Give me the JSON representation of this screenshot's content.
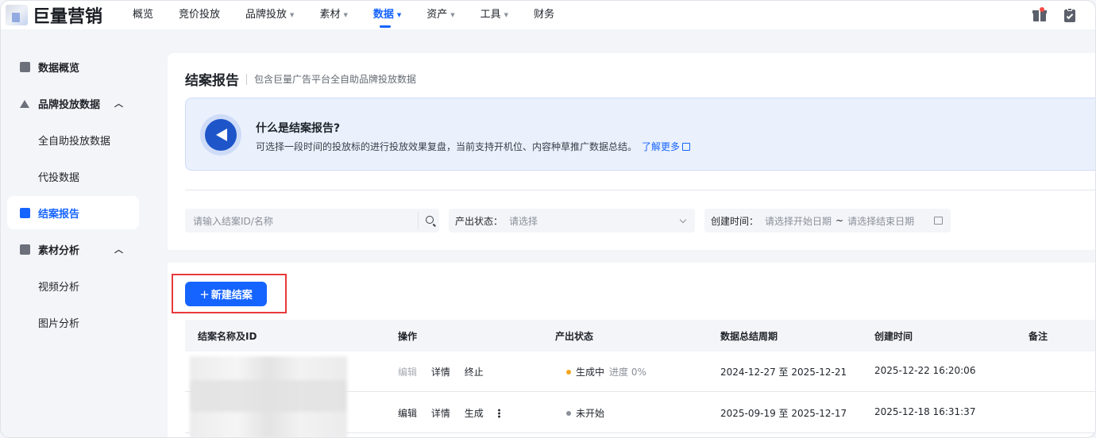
{
  "app": {
    "logo_text": "巨量营销"
  },
  "nav": {
    "items": [
      {
        "label": "概览",
        "has_caret": false,
        "active": false
      },
      {
        "label": "竞价投放",
        "has_caret": false,
        "active": false
      },
      {
        "label": "品牌投放",
        "has_caret": true,
        "active": false
      },
      {
        "label": "素材",
        "has_caret": true,
        "active": false
      },
      {
        "label": "数据",
        "has_caret": true,
        "active": true
      },
      {
        "label": "资产",
        "has_caret": true,
        "active": false
      },
      {
        "label": "工具",
        "has_caret": true,
        "active": false
      },
      {
        "label": "财务",
        "has_caret": false,
        "active": false
      }
    ],
    "right_icons": [
      "gift-icon",
      "clipboard-check-icon"
    ]
  },
  "sidebar": {
    "items": [
      {
        "label": "数据概览",
        "type": "group",
        "icon": "chart-icon"
      },
      {
        "label": "品牌投放数据",
        "type": "group",
        "icon": "crown-icon",
        "chevron": "︿"
      },
      {
        "label": "全自助投放数据",
        "type": "sub"
      },
      {
        "label": "代投数据",
        "type": "sub"
      },
      {
        "label": "结案报告",
        "type": "active",
        "icon": "trend-icon"
      },
      {
        "label": "素材分析",
        "type": "group",
        "icon": "material-icon",
        "chevron": "︿"
      },
      {
        "label": "视频分析",
        "type": "sub"
      },
      {
        "label": "图片分析",
        "type": "sub"
      }
    ]
  },
  "page": {
    "title": "结案报告",
    "description": "包含巨量广告平台全自助品牌投放数据"
  },
  "info": {
    "title": "什么是结案报告?",
    "text": "可选择一段时间的投放标的进行投放效果复盘，当前支持开机位、内容种草推广数据总结。",
    "link": "了解更多"
  },
  "filters": {
    "search_placeholder": "请输入结案ID/名称",
    "status_label": "产出状态：",
    "status_placeholder": "请选择",
    "date_label": "创建时间：",
    "date_start_placeholder": "请选择开始日期",
    "date_sep": "~",
    "date_end_placeholder": "请选择结束日期"
  },
  "actions": {
    "new_button": "新建结案",
    "new_button_icon": "+"
  },
  "table": {
    "headers": [
      "结案名称及ID",
      "操作",
      "产出状态",
      "数据总结周期",
      "创建时间",
      "备注"
    ],
    "rows": [
      {
        "ops": [
          {
            "label": "编辑",
            "disabled": true
          },
          {
            "label": "详情",
            "disabled": false
          },
          {
            "label": "终止",
            "disabled": false
          }
        ],
        "status": "生成中",
        "status_color": "#f5a623",
        "progress": "进度 0%",
        "period": "2024-12-27 至 2025-12-21",
        "created": "2025-12-22 16:20:06"
      },
      {
        "ops": [
          {
            "label": "编辑",
            "disabled": false
          },
          {
            "label": "详情",
            "disabled": false
          },
          {
            "label": "生成",
            "disabled": false
          }
        ],
        "has_more": true,
        "status": "未开始",
        "status_color": "#8a8f99",
        "progress": "",
        "period": "2025-09-19 至 2025-12-17",
        "created": "2025-12-18 16:31:37"
      }
    ]
  },
  "colors": {
    "accent": "#1664ff",
    "highlight_border": "#e83a3a"
  }
}
